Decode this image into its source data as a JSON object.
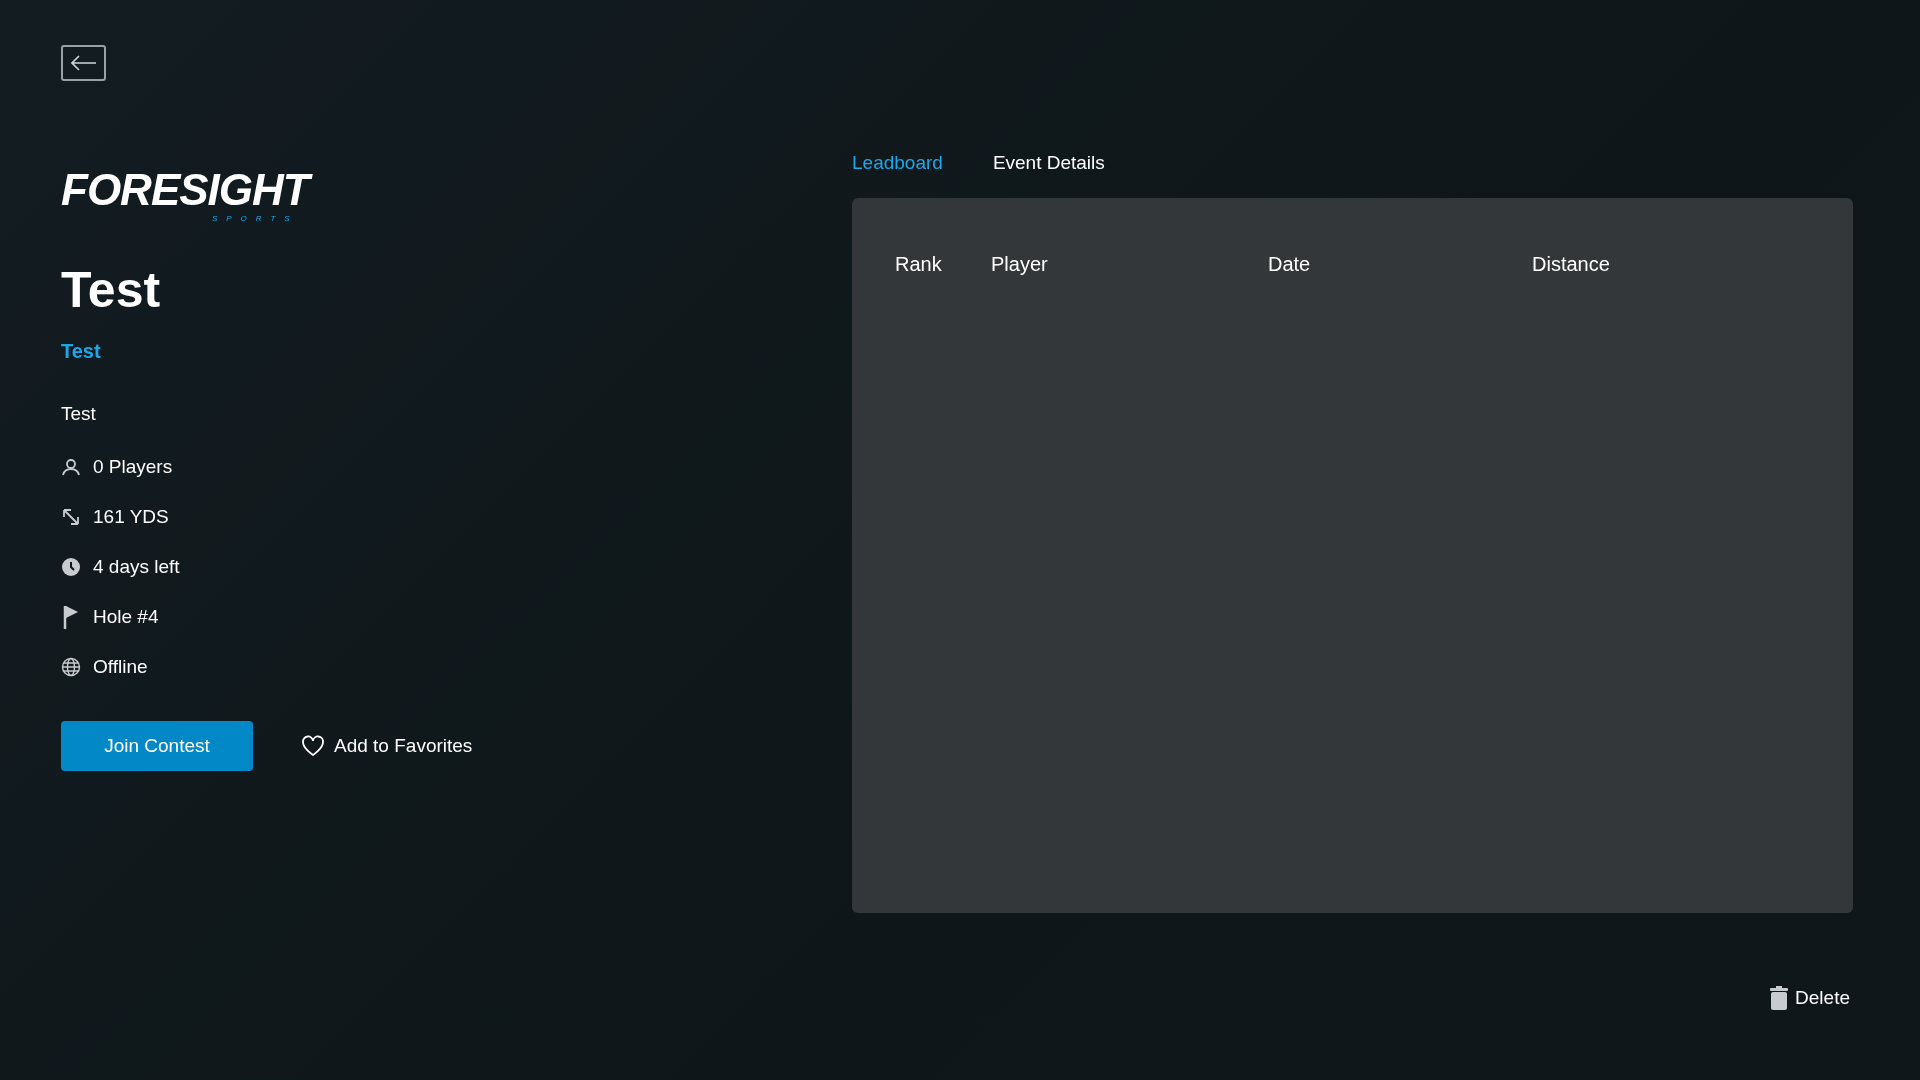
{
  "logo": {
    "wordmark": "FORESIGHT",
    "tagline": "SPORTS"
  },
  "contest": {
    "title": "Test",
    "subtitle": "Test",
    "description": "Test"
  },
  "stats": [
    {
      "kind": "players",
      "text": "0 Players"
    },
    {
      "kind": "distance",
      "text": "161 YDS"
    },
    {
      "kind": "time",
      "text": "4 days left"
    },
    {
      "kind": "hole",
      "text": "Hole #4"
    },
    {
      "kind": "mode",
      "text": "Offline"
    }
  ],
  "actions": {
    "join": "Join Contest",
    "favorite": "Add to Favorites",
    "favorited": false
  },
  "tabs": [
    {
      "label": "Leadboard",
      "selected": true
    },
    {
      "label": "Event Details",
      "selected": false
    }
  ],
  "table": {
    "columns": [
      "Rank",
      "Player",
      "Date",
      "Distance"
    ]
  },
  "delete": "Delete"
}
